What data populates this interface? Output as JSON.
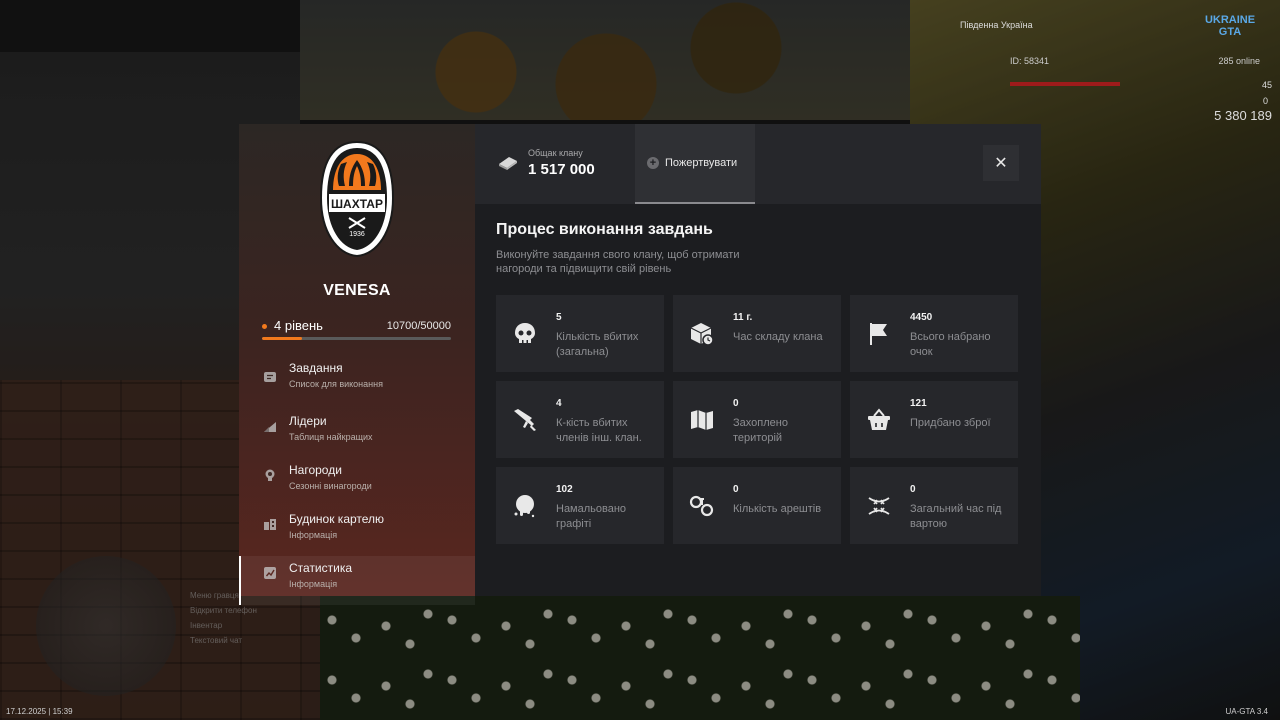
{
  "hud": {
    "region": "Південна Україна",
    "logo": "UKRAINE GTA",
    "player_id": "ID: 58341",
    "online": "285 online",
    "health": "45",
    "armor": "0",
    "money": "5 380 189",
    "datetime": "17.12.2025 | 15:39",
    "version": "UA-GTA 3.4",
    "menu_hints": [
      "Меню гравця",
      "Відкрити телефон",
      "Інвентар",
      "Текстовий чат"
    ]
  },
  "clan": {
    "crest_text": "ШАХТАР",
    "crest_year": "1936",
    "name": "VENESA",
    "level_label": "4 рівень",
    "xp": "10700/50000",
    "xp_progress": 0.214
  },
  "nav": [
    {
      "title": "Завдання",
      "subtitle": "Список для виконання",
      "icon": "list-icon"
    },
    {
      "title": "Лідери",
      "subtitle": "Таблиця найкращих",
      "icon": "chart-icon"
    },
    {
      "title": "Нагороди",
      "subtitle": "Сезонні винагороди",
      "icon": "trophy-icon"
    },
    {
      "title": "Будинок картелю",
      "subtitle": "Інформація",
      "icon": "building-icon"
    },
    {
      "title": "Статистика",
      "subtitle": "Інформація",
      "icon": "stats-icon"
    }
  ],
  "topbar": {
    "fund_label": "Общак клану",
    "fund_value": "1 517 000",
    "donate_label": "Пожертвувати",
    "close_symbol": "✕"
  },
  "section": {
    "title": "Процес виконання завдань",
    "description": "Виконуйте завдання свого клану, щоб отримати нагороди та підвищити свій рівень"
  },
  "stats": [
    {
      "value": "5",
      "label": "Кількість вбитих (загальна)",
      "icon": "skull-icon"
    },
    {
      "value": "11 г.",
      "label": "Час складу клана",
      "icon": "box-clock-icon"
    },
    {
      "value": "4450",
      "label": "Всього набрано очок",
      "icon": "flag-icon"
    },
    {
      "value": "4",
      "label": "К-кість вбитих членів інш. клан.",
      "icon": "rifle-icon"
    },
    {
      "value": "0",
      "label": "Захоплено територій",
      "icon": "map-icon"
    },
    {
      "value": "121",
      "label": "Придбано зброї",
      "icon": "basket-icon"
    },
    {
      "value": "102",
      "label": "Намальовано графіті",
      "icon": "spray-icon"
    },
    {
      "value": "0",
      "label": "Кількість арештів",
      "icon": "handcuffs-icon"
    },
    {
      "value": "0",
      "label": "Загальний час під вартою",
      "icon": "barbed-wire-icon"
    }
  ],
  "colors": {
    "accent": "#f2791d",
    "panel": "#1c1d20",
    "card": "#26272b",
    "sidebar_bottom": "#5a261f"
  }
}
